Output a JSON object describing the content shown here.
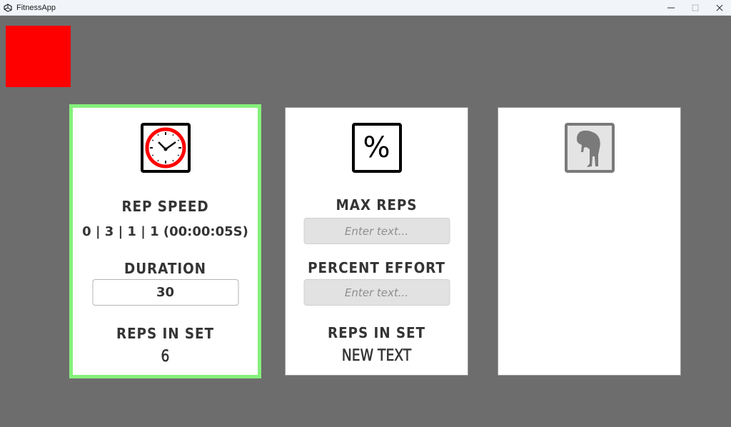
{
  "window": {
    "title": "FitnessApp",
    "icon": "unity-logo-icon",
    "controls": [
      "minimize",
      "maximize",
      "close"
    ]
  },
  "indicator": {
    "color": "#ff0000"
  },
  "cards": [
    {
      "selected": true,
      "icon": "clock-icon",
      "rep_speed_label": "REP SPEED",
      "rep_speed_value": "0 | 3 | 1 | 1 (00:00:05S)",
      "duration_label": "DURATION",
      "duration_value": "30",
      "reps_label": "REPS IN SET",
      "reps_value": "6"
    },
    {
      "selected": false,
      "icon": "percent-icon",
      "icon_glyph": "%",
      "max_reps_label": "MAX REPS",
      "max_reps_placeholder": "Enter text...",
      "percent_effort_label": "PERCENT EFFORT",
      "percent_effort_placeholder": "Enter text...",
      "reps_label": "REPS IN SET",
      "reps_value": "NEW TEXT"
    },
    {
      "selected": false,
      "icon": "exhausted-person-icon"
    }
  ],
  "colors": {
    "background": "#6d6d6d",
    "selected_border": "#86f07c",
    "text": "#343434"
  }
}
